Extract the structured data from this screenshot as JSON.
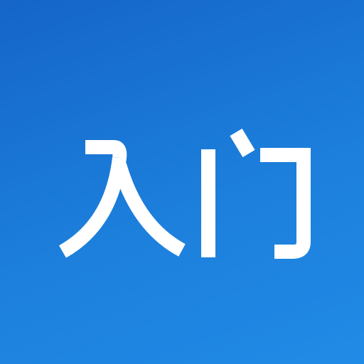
{
  "tile": {
    "text": "入门",
    "characters": [
      "入",
      "门"
    ],
    "background_colors": [
      "#1565c8",
      "#208be6"
    ],
    "text_color": "#ffffff"
  }
}
